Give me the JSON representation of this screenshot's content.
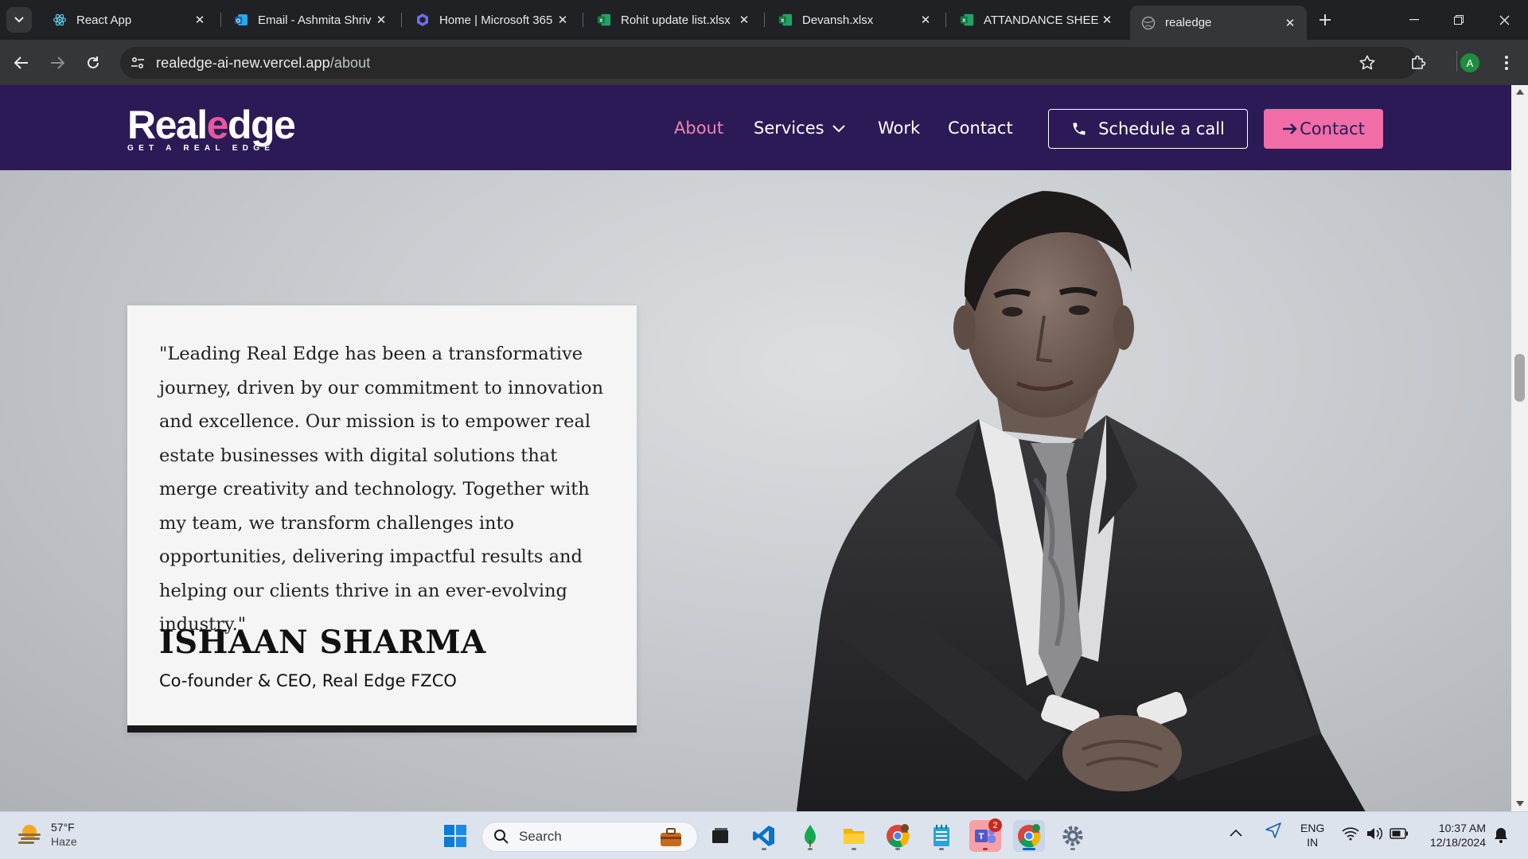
{
  "browser": {
    "tabs": [
      {
        "title": "React App",
        "icon": "react-icon"
      },
      {
        "title": "Email - Ashmita Shriv",
        "icon": "outlook-icon"
      },
      {
        "title": "Home | Microsoft 365",
        "icon": "microsoft365-icon"
      },
      {
        "title": "Rohit update list.xlsx",
        "icon": "excel-icon"
      },
      {
        "title": "Devansh.xlsx",
        "icon": "excel-icon"
      },
      {
        "title": "ATTANDANCE SHEET",
        "icon": "excel-icon"
      },
      {
        "title": "realedge",
        "icon": "globe-icon",
        "active": true
      }
    ],
    "url_host": "realedge-ai-new.vercel.app",
    "url_path": "/about",
    "profile_initial": "A"
  },
  "site": {
    "logo": {
      "word_start": "Real",
      "word_accent": "e",
      "word_end": "dge",
      "tagline": "GET A REAL EDGE"
    },
    "nav": {
      "about": "About",
      "services": "Services",
      "work": "Work",
      "contact": "Contact"
    },
    "schedule_label": "Schedule a call",
    "contact_label": "Contact",
    "colors": {
      "header_bg": "#2b1a55",
      "accent_pink": "#f06da8",
      "active_nav": "#f084b6"
    }
  },
  "quote": {
    "text": "\"Leading Real Edge has been a transformative journey, driven by our commitment to innovation and excellence. Our mission is to empower real estate businesses with digital solutions that merge creativity and technology. Together with my team, we transform challenges into opportunities, delivering impactful results and helping our clients thrive in an ever-evolving industry.\"",
    "author": "ISHAAN SHARMA",
    "role": "Co-founder & CEO, Real Edge FZCO"
  },
  "taskbar": {
    "weather_temp": "57°F",
    "weather_desc": "Haze",
    "search_label": "Search",
    "teams_badge": "2",
    "lang_top": "ENG",
    "lang_bottom": "IN",
    "time": "10:37 AM",
    "date": "12/18/2024"
  }
}
